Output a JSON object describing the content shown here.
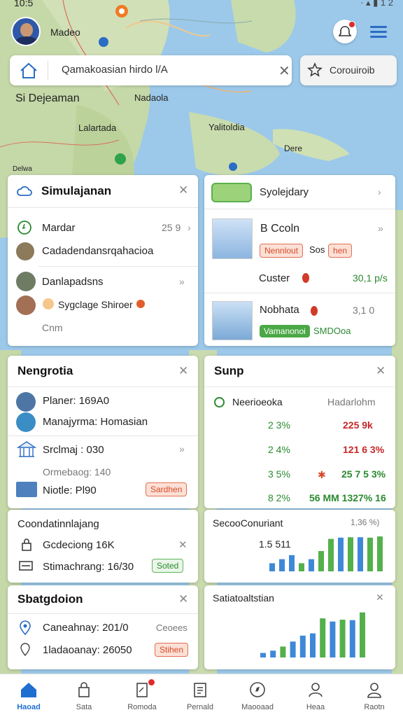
{
  "status_bar": {
    "time": "10:5",
    "right": "· ▴ ▮ 1 2"
  },
  "header": {
    "place": "Madeo"
  },
  "map_labels": {
    "city1": "Si Dejeaman",
    "city2": "Nadaola",
    "city3": "Lalartada",
    "city4": "Yalitoldia",
    "city5": "Dere",
    "city6": "Delwa"
  },
  "search": {
    "query": "Qamakoasian hirdo l/A"
  },
  "coord_button": {
    "label": "Corouiroib"
  },
  "card_simulation": {
    "title": "Simulajanan",
    "row1_label": "Mardar",
    "row1_value": "25 9",
    "row2_label": "Cadadendansrqahacioa",
    "row3_label": "Danlapadsns",
    "row4_label": "Sygclage Shiroer",
    "row5_label": "Cnm"
  },
  "card_spec": {
    "title": "Syolejdary",
    "item1_label": "B Ccoln",
    "item1_pill_a": "Nennlout",
    "item1_pill_b": "Sos",
    "item1_pill_c": "hen",
    "item2_label": "Custer",
    "item2_value": "30,1 p/s",
    "item3_label": "Nobhata",
    "item3_value": "3,1 0",
    "item3_pill_a": "Vamanonoi",
    "item3_pill_b": "SMDOoa"
  },
  "card_neg": {
    "title": "Nengrotia",
    "row1": "Planer: 169A0",
    "row2": "Manajyrma: Homasian",
    "row3": "Srclmaj : 030",
    "row4": "Ormebaog: 140",
    "row5": "Niotle: Pl90",
    "row5_pill": "Sardhen"
  },
  "card_sunp": {
    "title": "Sunp",
    "header_left": "Neerioeoka",
    "header_right": "Hadarlohm",
    "rows": [
      {
        "a": "2 3%",
        "b": "225 9k"
      },
      {
        "a": "2 4%",
        "b": "121 6 3%"
      },
      {
        "a": "3 5%",
        "b": "25 7 5 3%"
      },
      {
        "a": "8 2%",
        "b": "56 MM 1327% 16"
      }
    ]
  },
  "card_coord": {
    "title": "Coondatinnlajang",
    "row1": "Gcdeciong 16K",
    "row2": "Stimachrang: 16/30",
    "row2_pill": "Soted"
  },
  "card_chart1": {
    "title": "SecooConuriant",
    "corner": "1,36 %)",
    "value": "1.5 511"
  },
  "card_stat": {
    "title": "Sbatgdoion",
    "row1": "Caneahnay: 201/0",
    "row1_right": "Ceoees",
    "row2": "1ladaoanay: 26050",
    "row2_pill": "Stihen"
  },
  "card_chart2": {
    "title": "Satiatoaltstian"
  },
  "chart_data": [
    {
      "type": "bar",
      "title": "SecooConuriant",
      "series": [
        {
          "values": [
            2,
            3,
            4,
            2,
            3,
            5,
            8,
            8,
            8,
            8,
            8,
            8
          ]
        }
      ],
      "colors": [
        "#3f88d8",
        "#3f88d8",
        "#3f88d8",
        "#54b04a",
        "#3f88d8",
        "#54b04a",
        "#54b04a",
        "#3f88d8",
        "#54b04a",
        "#3f88d8",
        "#54b04a",
        "#54b04a"
      ],
      "heights": [
        2,
        3,
        4,
        2,
        3,
        5,
        8,
        8.3,
        8.4,
        8.4,
        8.3,
        8.6
      ]
    },
    {
      "type": "bar",
      "title": "Satiatoaltstian",
      "colors": [
        "#3f88d8",
        "#3f88d8",
        "#54b04a",
        "#3f88d8",
        "#3f88d8",
        "#3f88d8",
        "#54b04a",
        "#3f88d8",
        "#54b04a",
        "#3f88d8",
        "#54b04a"
      ],
      "heights": [
        1,
        1.5,
        2.4,
        3.5,
        4.8,
        5.3,
        8.6,
        7.9,
        8.3,
        8.2,
        9.9
      ]
    }
  ],
  "nav": {
    "items": [
      {
        "label": "Haoad"
      },
      {
        "label": "Sata"
      },
      {
        "label": "Romoda"
      },
      {
        "label": "Pernald"
      },
      {
        "label": "Maooaad"
      },
      {
        "label": "Heaa"
      },
      {
        "label": "Raotn"
      }
    ]
  },
  "colors": {
    "accent": "#1f6fd1",
    "green": "#2a8a2f",
    "red": "#c62828"
  }
}
